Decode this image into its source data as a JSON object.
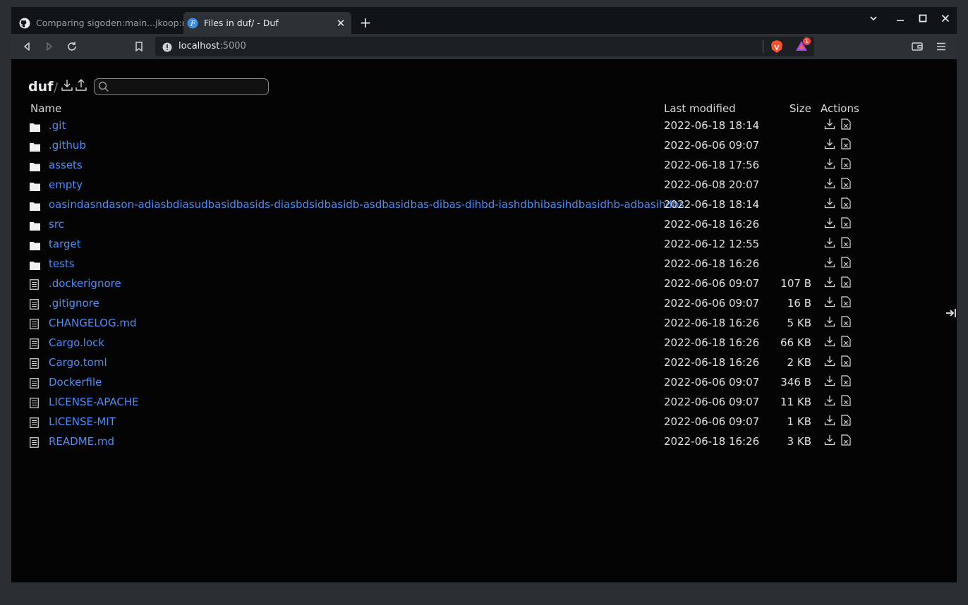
{
  "browser": {
    "tabs": [
      {
        "title": "Comparing sigoden:main...jkoop:re",
        "icon": "github-icon",
        "active": false
      },
      {
        "title": "Files in duf/ - Duf",
        "icon": "duf-icon",
        "active": true
      }
    ],
    "address": {
      "host": "localhost",
      "port": ":5000"
    },
    "brave_badge_count": "1",
    "accent_color": "#4c8df6"
  },
  "page": {
    "breadcrumb": {
      "root": "duf",
      "separator": "/"
    },
    "search": {
      "placeholder": ""
    },
    "columns": {
      "name": "Name",
      "modified": "Last modified",
      "size": "Size",
      "actions": "Actions"
    },
    "rows": [
      {
        "type": "folder",
        "name": ".git",
        "modified": "2022-06-18 18:14",
        "size": ""
      },
      {
        "type": "folder",
        "name": ".github",
        "modified": "2022-06-06 09:07",
        "size": ""
      },
      {
        "type": "folder",
        "name": "assets",
        "modified": "2022-06-18 17:56",
        "size": ""
      },
      {
        "type": "folder",
        "name": "empty",
        "modified": "2022-06-08 20:07",
        "size": ""
      },
      {
        "type": "folder",
        "name": "oasindasndason-adiasbdiasudbasidbasids-diasbdsidbasidb-asdbasidbas-dibas-dihbd-iashdbhibasihdbasidhb-adbasihdbs",
        "modified": "2022-06-18 18:14",
        "size": ""
      },
      {
        "type": "folder",
        "name": "src",
        "modified": "2022-06-18 16:26",
        "size": ""
      },
      {
        "type": "folder",
        "name": "target",
        "modified": "2022-06-12 12:55",
        "size": ""
      },
      {
        "type": "folder",
        "name": "tests",
        "modified": "2022-06-18 16:26",
        "size": ""
      },
      {
        "type": "file",
        "name": ".dockerignore",
        "modified": "2022-06-06 09:07",
        "size": "107 B"
      },
      {
        "type": "file",
        "name": ".gitignore",
        "modified": "2022-06-06 09:07",
        "size": "16 B"
      },
      {
        "type": "file",
        "name": "CHANGELOG.md",
        "modified": "2022-06-18 16:26",
        "size": "5 KB"
      },
      {
        "type": "file",
        "name": "Cargo.lock",
        "modified": "2022-06-18 16:26",
        "size": "66 KB"
      },
      {
        "type": "file",
        "name": "Cargo.toml",
        "modified": "2022-06-18 16:26",
        "size": "2 KB"
      },
      {
        "type": "file",
        "name": "Dockerfile",
        "modified": "2022-06-06 09:07",
        "size": "346 B"
      },
      {
        "type": "file",
        "name": "LICENSE-APACHE",
        "modified": "2022-06-06 09:07",
        "size": "11 KB"
      },
      {
        "type": "file",
        "name": "LICENSE-MIT",
        "modified": "2022-06-06 09:07",
        "size": "1 KB"
      },
      {
        "type": "file",
        "name": "README.md",
        "modified": "2022-06-18 16:26",
        "size": "3 KB"
      }
    ]
  }
}
